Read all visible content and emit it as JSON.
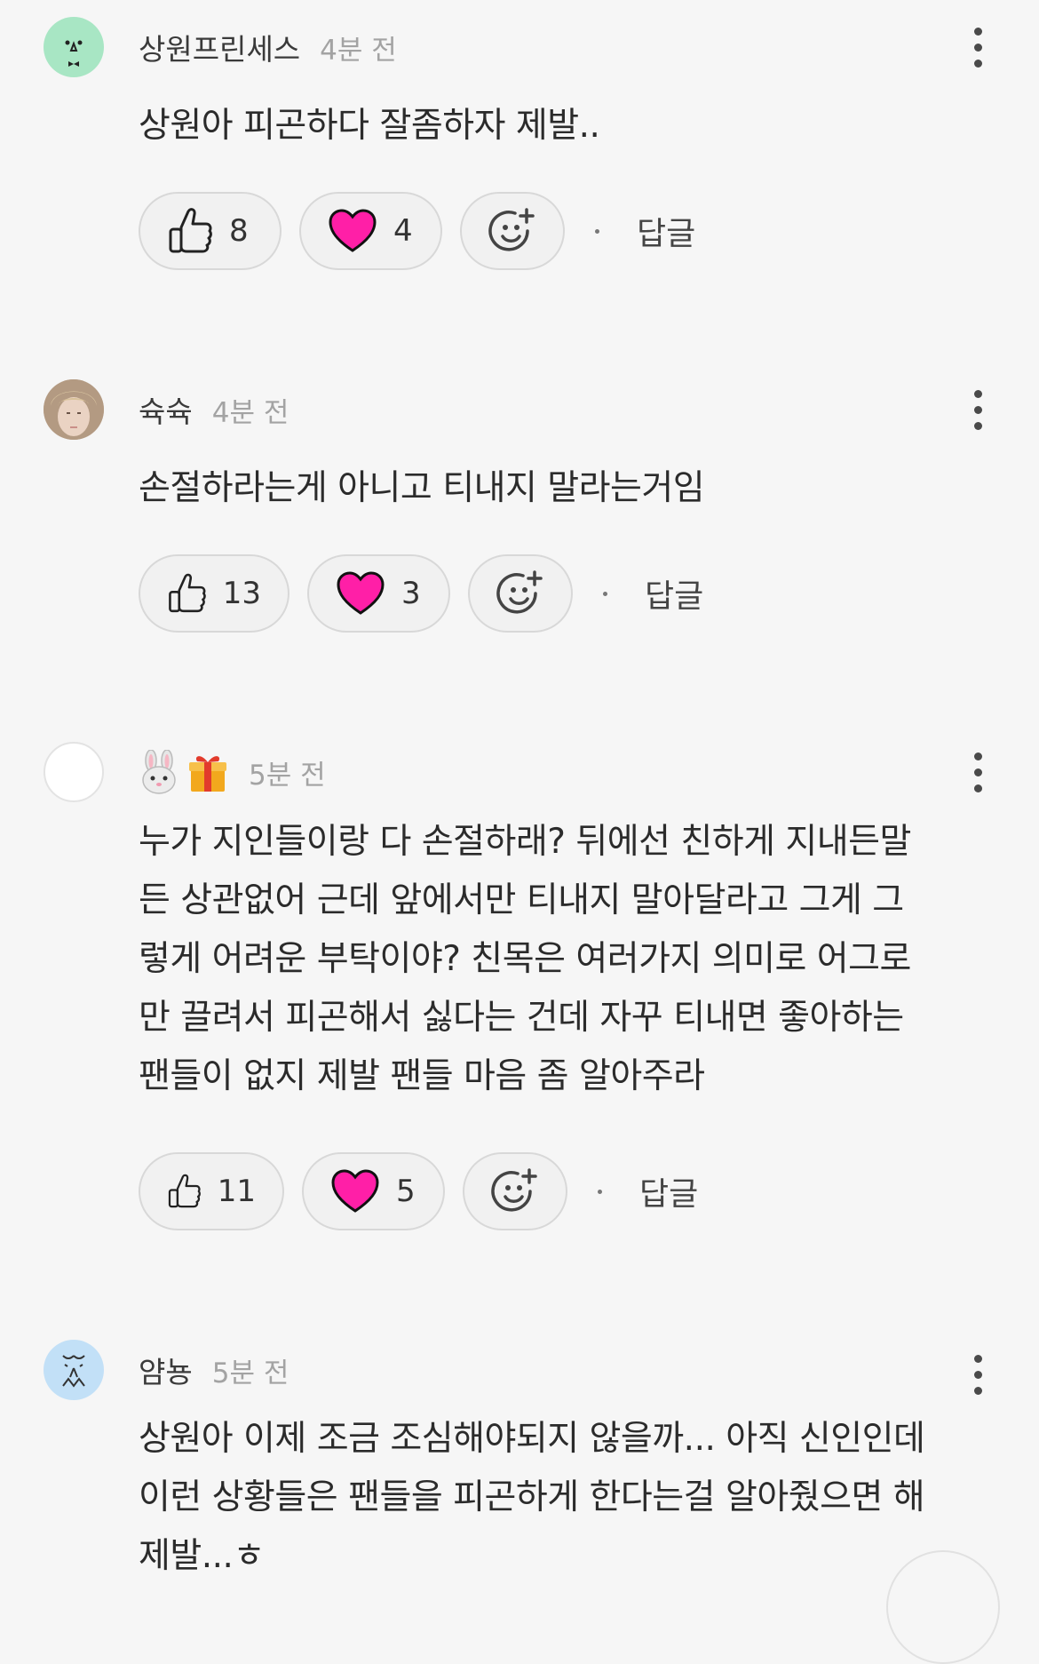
{
  "comments": [
    {
      "author": "상원프린세스",
      "time": "4분 전",
      "text": "상원아 피곤하다 잘좀하자 제발..",
      "likes": "8",
      "hearts": "4",
      "reply_label": "답글",
      "avatar_icon": "green-face-avatar"
    },
    {
      "author": "슉슉",
      "time": "4분 전",
      "text": "손절하라는게 아니고 티내지 말라는거임",
      "likes": "13",
      "hearts": "3",
      "reply_label": "답글",
      "avatar_icon": "photo-avatar"
    },
    {
      "author": "🐰🎁",
      "time": "5분 전",
      "text_lines": [
        "누가 지인들이랑 다 손절하래? 뒤에선 친하게 지내든말",
        "든 상관없어 근데 앞에서만 티내지 말아달라고 그게 그",
        "렇게 어려운 부탁이야? 친목은 여러가지 의미로 어그로",
        "만 끌려서 피곤해서 싫다는 건데 자꾸 티내면 좋아하는",
        "팬들이 없지 제발 팬들 마음 좀 알아주라"
      ],
      "likes": "11",
      "hearts": "5",
      "reply_label": "답글",
      "avatar_icon": "blank-avatar"
    },
    {
      "author": "얌뇽",
      "time": "5분 전",
      "text_lines": [
        "상원아 이제 조금 조심해야되지 않을까... 아직 신인인데",
        "이런 상황들은 팬들을 피곤하게 한다는걸 알아줬으면 해",
        "제발...ㅎ"
      ],
      "avatar_icon": "blue-face-avatar"
    }
  ],
  "colors": {
    "background": "#f6f6f6",
    "heart": "#ff1fa7",
    "avatar_green": "#9fe3bf",
    "avatar_blue": "#bcdcf5"
  }
}
